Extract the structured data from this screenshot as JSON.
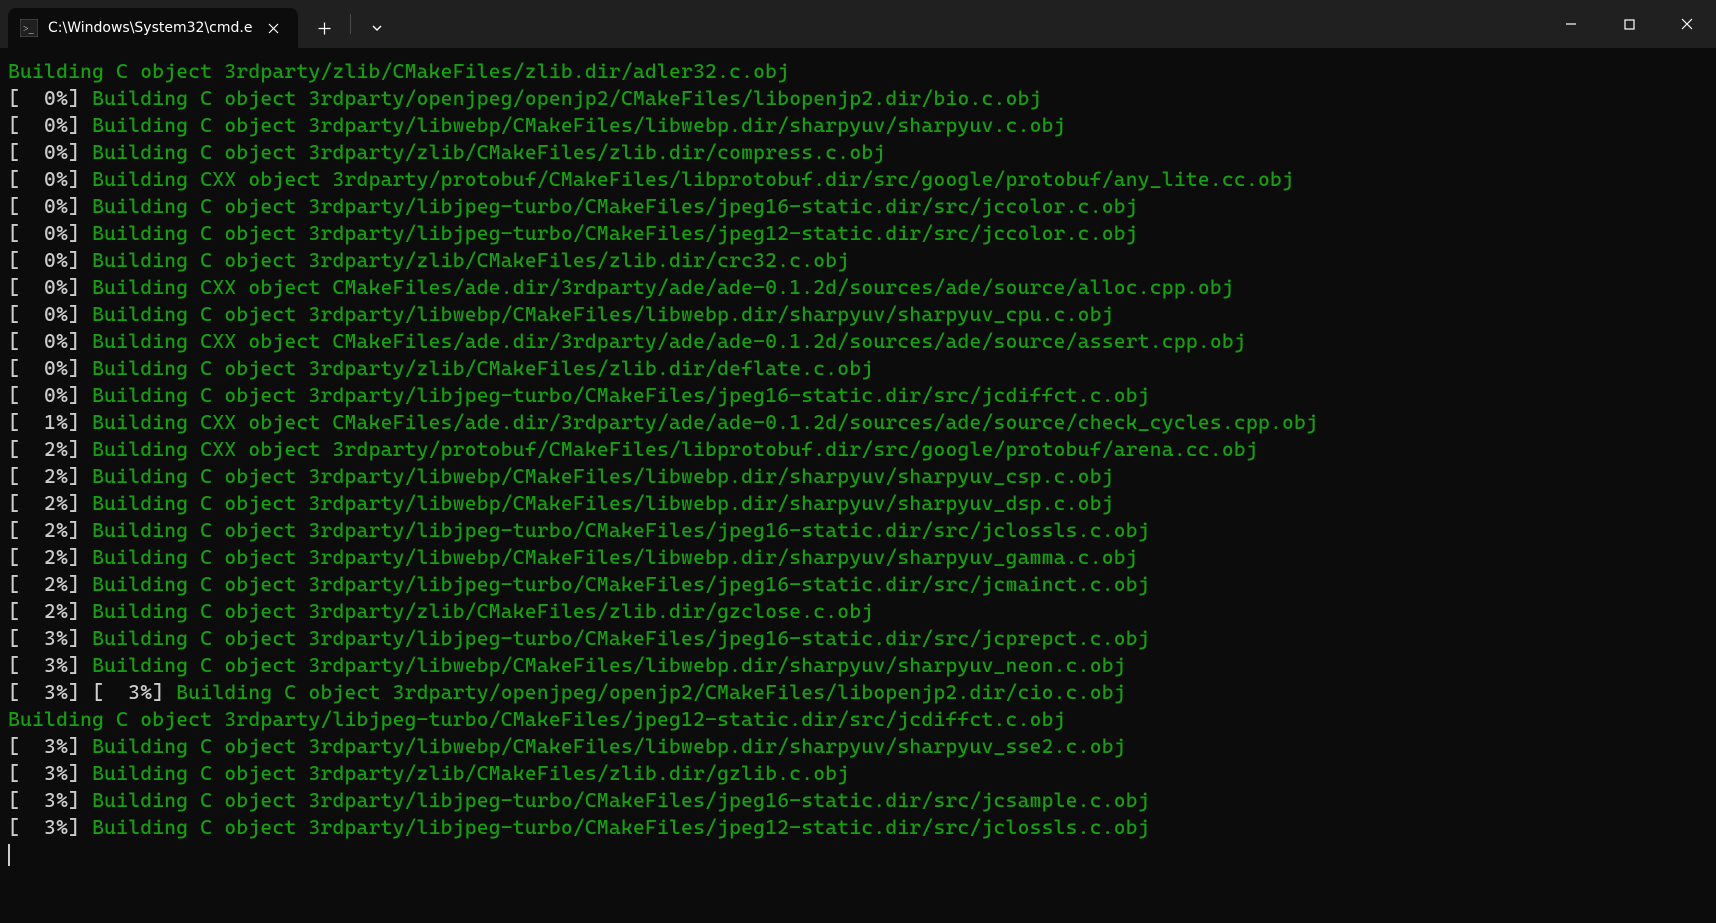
{
  "window": {
    "tab_title": "C:\\Windows\\System32\\cmd.e"
  },
  "colors": {
    "green": "#13a10e",
    "fg": "#cccccc",
    "bg": "#0c0c0c",
    "titlebar": "#202020"
  },
  "lines": [
    {
      "type": "plain_green",
      "text": "Building C object 3rdparty/zlib/CMakeFiles/zlib.dir/adler32.c.obj"
    },
    {
      "type": "pct",
      "pct": "0",
      "msg": "Building C object 3rdparty/openjpeg/openjp2/CMakeFiles/libopenjp2.dir/bio.c.obj"
    },
    {
      "type": "pct",
      "pct": "0",
      "msg": "Building C object 3rdparty/libwebp/CMakeFiles/libwebp.dir/sharpyuv/sharpyuv.c.obj"
    },
    {
      "type": "pct",
      "pct": "0",
      "msg": "Building C object 3rdparty/zlib/CMakeFiles/zlib.dir/compress.c.obj"
    },
    {
      "type": "pct",
      "pct": "0",
      "msg": "Building CXX object 3rdparty/protobuf/CMakeFiles/libprotobuf.dir/src/google/protobuf/any_lite.cc.obj"
    },
    {
      "type": "pct",
      "pct": "0",
      "msg": "Building C object 3rdparty/libjpeg-turbo/CMakeFiles/jpeg16-static.dir/src/jccolor.c.obj"
    },
    {
      "type": "pct",
      "pct": "0",
      "msg": "Building C object 3rdparty/libjpeg-turbo/CMakeFiles/jpeg12-static.dir/src/jccolor.c.obj"
    },
    {
      "type": "pct",
      "pct": "0",
      "msg": "Building C object 3rdparty/zlib/CMakeFiles/zlib.dir/crc32.c.obj"
    },
    {
      "type": "pct",
      "pct": "0",
      "msg": "Building CXX object CMakeFiles/ade.dir/3rdparty/ade/ade-0.1.2d/sources/ade/source/alloc.cpp.obj"
    },
    {
      "type": "pct",
      "pct": "0",
      "msg": "Building C object 3rdparty/libwebp/CMakeFiles/libwebp.dir/sharpyuv/sharpyuv_cpu.c.obj"
    },
    {
      "type": "pct",
      "pct": "0",
      "msg": "Building CXX object CMakeFiles/ade.dir/3rdparty/ade/ade-0.1.2d/sources/ade/source/assert.cpp.obj"
    },
    {
      "type": "pct",
      "pct": "0",
      "msg": "Building C object 3rdparty/zlib/CMakeFiles/zlib.dir/deflate.c.obj"
    },
    {
      "type": "pct",
      "pct": "0",
      "msg": "Building C object 3rdparty/libjpeg-turbo/CMakeFiles/jpeg16-static.dir/src/jcdiffct.c.obj"
    },
    {
      "type": "pct",
      "pct": "1",
      "msg": "Building CXX object CMakeFiles/ade.dir/3rdparty/ade/ade-0.1.2d/sources/ade/source/check_cycles.cpp.obj"
    },
    {
      "type": "pct",
      "pct": "2",
      "msg": "Building CXX object 3rdparty/protobuf/CMakeFiles/libprotobuf.dir/src/google/protobuf/arena.cc.obj"
    },
    {
      "type": "pct",
      "pct": "2",
      "msg": "Building C object 3rdparty/libwebp/CMakeFiles/libwebp.dir/sharpyuv/sharpyuv_csp.c.obj"
    },
    {
      "type": "pct",
      "pct": "2",
      "msg": "Building C object 3rdparty/libwebp/CMakeFiles/libwebp.dir/sharpyuv/sharpyuv_dsp.c.obj"
    },
    {
      "type": "pct",
      "pct": "2",
      "msg": "Building C object 3rdparty/libjpeg-turbo/CMakeFiles/jpeg16-static.dir/src/jclossls.c.obj"
    },
    {
      "type": "pct",
      "pct": "2",
      "msg": "Building C object 3rdparty/libwebp/CMakeFiles/libwebp.dir/sharpyuv/sharpyuv_gamma.c.obj"
    },
    {
      "type": "pct",
      "pct": "2",
      "msg": "Building C object 3rdparty/libjpeg-turbo/CMakeFiles/jpeg16-static.dir/src/jcmainct.c.obj"
    },
    {
      "type": "pct",
      "pct": "2",
      "msg": "Building C object 3rdparty/zlib/CMakeFiles/zlib.dir/gzclose.c.obj"
    },
    {
      "type": "pct",
      "pct": "3",
      "msg": "Building C object 3rdparty/libjpeg-turbo/CMakeFiles/jpeg16-static.dir/src/jcprepct.c.obj"
    },
    {
      "type": "pct",
      "pct": "3",
      "msg": "Building C object 3rdparty/libwebp/CMakeFiles/libwebp.dir/sharpyuv/sharpyuv_neon.c.obj"
    },
    {
      "type": "double_pct",
      "pct1": "3",
      "pct2": "3",
      "msg": "Building C object 3rdparty/openjpeg/openjp2/CMakeFiles/libopenjp2.dir/cio.c.obj"
    },
    {
      "type": "plain_green",
      "text": "Building C object 3rdparty/libjpeg-turbo/CMakeFiles/jpeg12-static.dir/src/jcdiffct.c.obj"
    },
    {
      "type": "pct",
      "pct": "3",
      "msg": "Building C object 3rdparty/libwebp/CMakeFiles/libwebp.dir/sharpyuv/sharpyuv_sse2.c.obj"
    },
    {
      "type": "pct",
      "pct": "3",
      "msg": "Building C object 3rdparty/zlib/CMakeFiles/zlib.dir/gzlib.c.obj"
    },
    {
      "type": "pct",
      "pct": "3",
      "msg": "Building C object 3rdparty/libjpeg-turbo/CMakeFiles/jpeg16-static.dir/src/jcsample.c.obj"
    },
    {
      "type": "pct",
      "pct": "3",
      "msg": "Building C object 3rdparty/libjpeg-turbo/CMakeFiles/jpeg12-static.dir/src/jclossls.c.obj"
    }
  ]
}
